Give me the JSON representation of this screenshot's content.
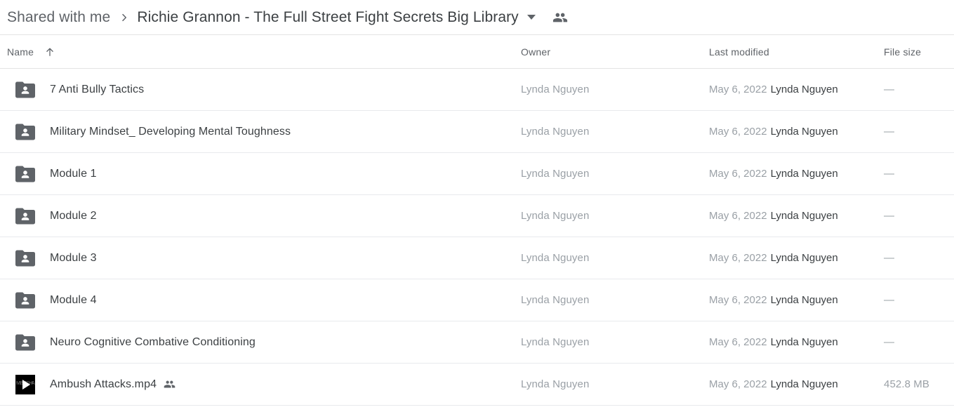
{
  "breadcrumb": {
    "root_label": "Shared with me",
    "separator": "chevron-right-icon",
    "current_label": "Richie Grannon - The Full Street Fight Secrets Big Library",
    "caret": "dropdown-caret-icon",
    "people_icon": "people-shared-icon"
  },
  "columns": {
    "name": "Name",
    "sort_direction": "ascending",
    "owner": "Owner",
    "last_modified": "Last modified",
    "file_size": "File size"
  },
  "rows": [
    {
      "icon": "shared-folder-icon",
      "type": "folder",
      "name": "7 Anti Bully Tactics",
      "shared": false,
      "owner": "Lynda Nguyen",
      "modified_date": "May 6, 2022",
      "modified_by": "Lynda Nguyen",
      "size": "—"
    },
    {
      "icon": "shared-folder-icon",
      "type": "folder",
      "name": "Military Mindset_ Developing Mental Toughness",
      "shared": false,
      "owner": "Lynda Nguyen",
      "modified_date": "May 6, 2022",
      "modified_by": "Lynda Nguyen",
      "size": "—"
    },
    {
      "icon": "shared-folder-icon",
      "type": "folder",
      "name": "Module 1",
      "shared": false,
      "owner": "Lynda Nguyen",
      "modified_date": "May 6, 2022",
      "modified_by": "Lynda Nguyen",
      "size": "—"
    },
    {
      "icon": "shared-folder-icon",
      "type": "folder",
      "name": "Module 2",
      "shared": false,
      "owner": "Lynda Nguyen",
      "modified_date": "May 6, 2022",
      "modified_by": "Lynda Nguyen",
      "size": "—"
    },
    {
      "icon": "shared-folder-icon",
      "type": "folder",
      "name": "Module 3",
      "shared": false,
      "owner": "Lynda Nguyen",
      "modified_date": "May 6, 2022",
      "modified_by": "Lynda Nguyen",
      "size": "—"
    },
    {
      "icon": "shared-folder-icon",
      "type": "folder",
      "name": "Module 4",
      "shared": false,
      "owner": "Lynda Nguyen",
      "modified_date": "May 6, 2022",
      "modified_by": "Lynda Nguyen",
      "size": "—"
    },
    {
      "icon": "shared-folder-icon",
      "type": "folder",
      "name": "Neuro Cognitive Combative Conditioning",
      "shared": false,
      "owner": "Lynda Nguyen",
      "modified_date": "May 6, 2022",
      "modified_by": "Lynda Nguyen",
      "size": "—"
    },
    {
      "icon": "video-file-icon",
      "type": "video",
      "name": "Ambush Attacks.mp4",
      "shared": true,
      "owner": "Lynda Nguyen",
      "modified_date": "May 6, 2022",
      "modified_by": "Lynda Nguyen",
      "size": "452.8 MB"
    }
  ],
  "colors": {
    "text_primary": "#3c4043",
    "text_secondary": "#5f6368",
    "text_muted": "#9aa0a6",
    "divider": "#e8eaed",
    "background": "#ffffff"
  }
}
